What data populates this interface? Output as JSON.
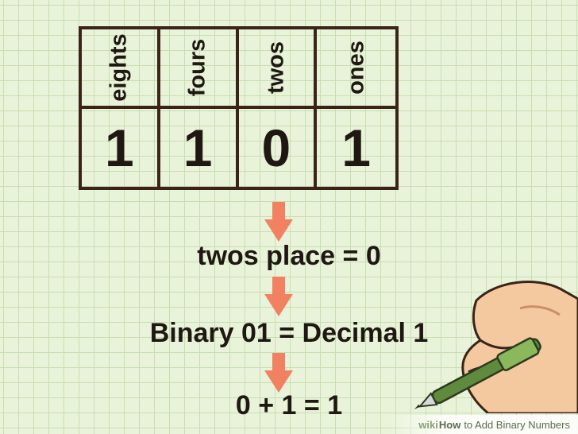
{
  "table": {
    "headers": [
      "eights",
      "fours",
      "twos",
      "ones"
    ],
    "digits": [
      "1",
      "1",
      "0",
      "1"
    ]
  },
  "steps": [
    "twos place = 0",
    "Binary 01 = Decimal 1",
    "0 + 1 = 1"
  ],
  "footer": {
    "brand_prefix": "wiki",
    "brand_suffix": "How",
    "title": "to Add Binary Numbers"
  },
  "colors": {
    "arrow": "#f28161",
    "grid_background": "#e9f3d9",
    "table_border": "#3a2418"
  },
  "icons": [
    "down-arrow-icon",
    "hand-holding-pen-icon"
  ]
}
